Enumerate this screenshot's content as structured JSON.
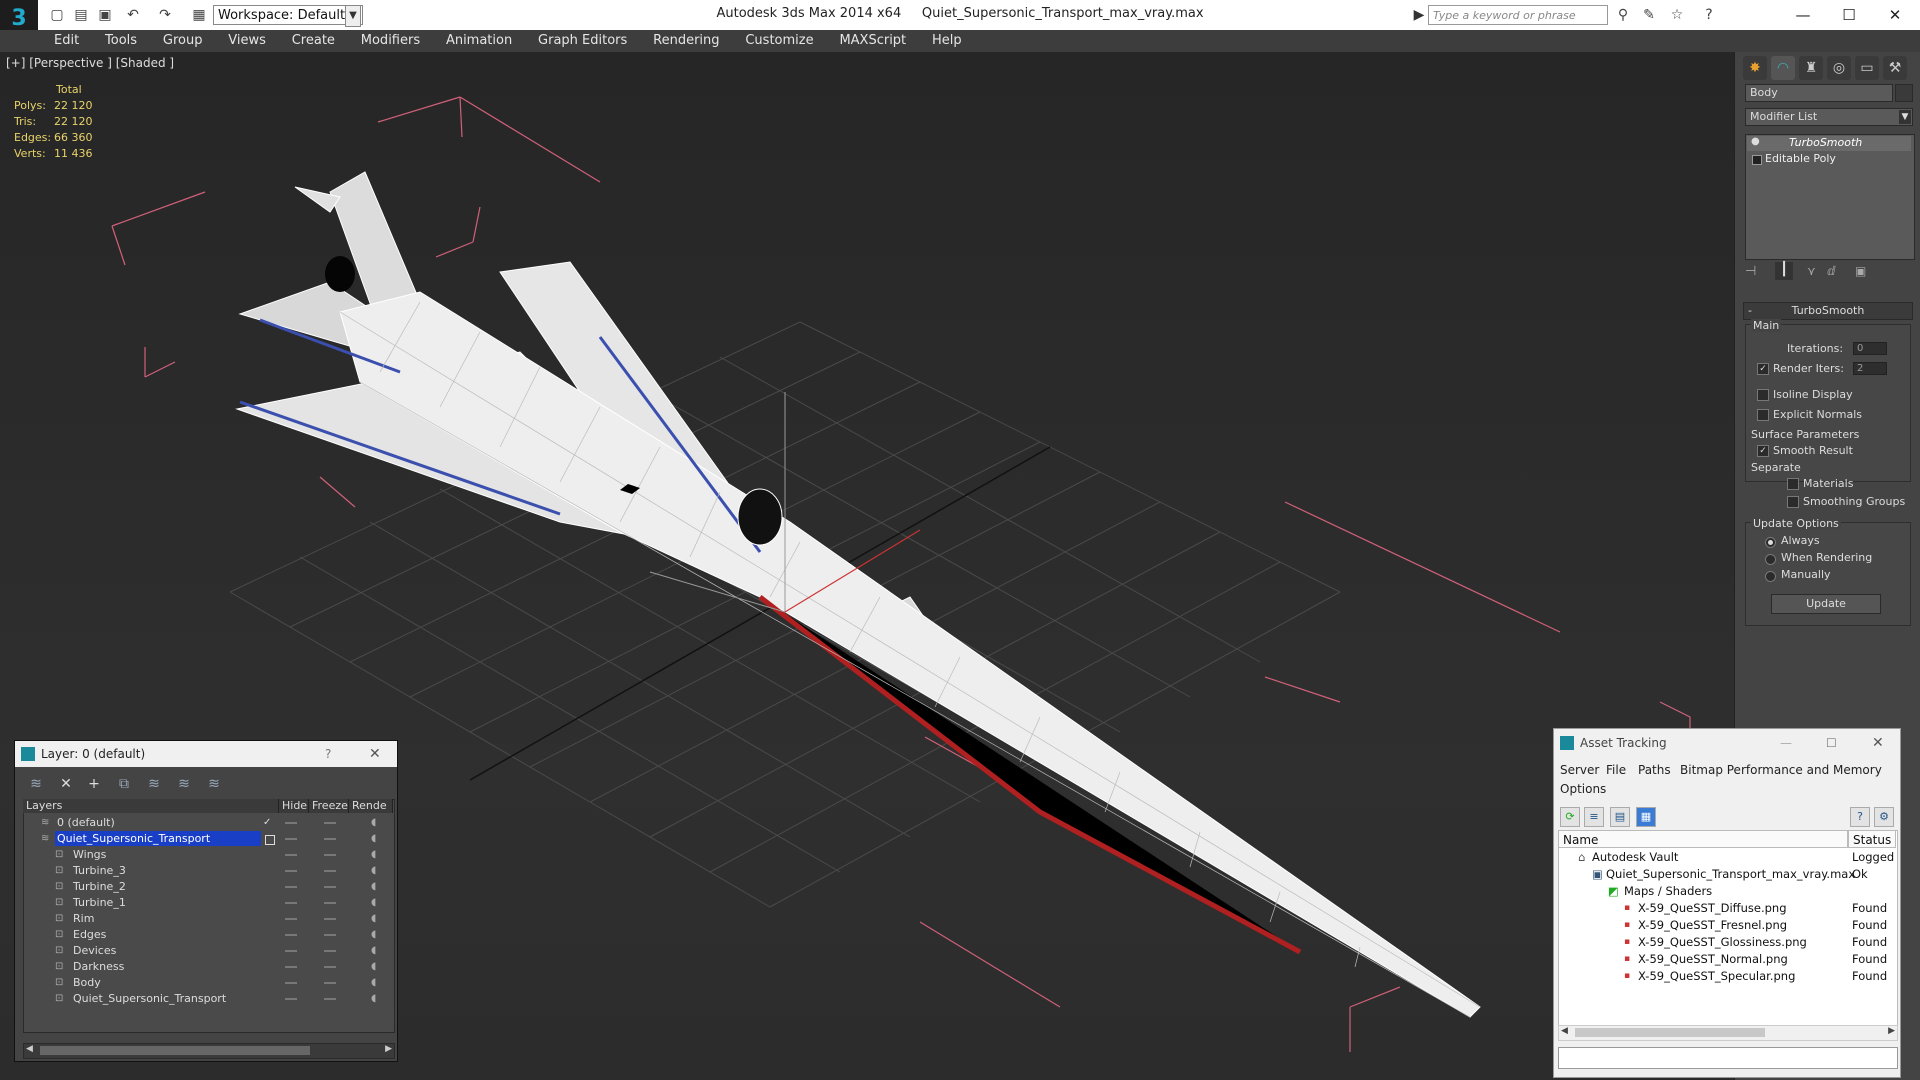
{
  "window": {
    "app_title": "Autodesk 3ds Max 2014 x64",
    "file_title": "Quiet_Supersonic_Transport_max_vray.max",
    "workspace": "Workspace: Default",
    "search_placeholder": "Type a keyword or phrase"
  },
  "menu": [
    "Edit",
    "Tools",
    "Group",
    "Views",
    "Create",
    "Modifiers",
    "Animation",
    "Graph Editors",
    "Rendering",
    "Customize",
    "MAXScript",
    "Help"
  ],
  "viewport": {
    "label": "[+] [Perspective ] [Shaded ]",
    "stats": {
      "header": "Total",
      "rows": [
        {
          "k": "Polys:",
          "v": "22 120"
        },
        {
          "k": "Tris:",
          "v": "22 120"
        },
        {
          "k": "Edges:",
          "v": "66 360"
        },
        {
          "k": "Verts:",
          "v": "11 436"
        }
      ]
    }
  },
  "command_panel": {
    "object_name": "Body",
    "modifier_list": "Modifier List",
    "stack": [
      "TurboSmooth",
      "Editable Poly"
    ],
    "rollout": "TurboSmooth",
    "main": "Main",
    "iterations_label": "Iterations:",
    "iterations_value": "0",
    "render_iters_label": "Render Iters:",
    "render_iters_value": "2",
    "isoline": "Isoline Display",
    "explicit_normals": "Explicit Normals",
    "surface_params": "Surface Parameters",
    "smooth_result": "Smooth Result",
    "separate": "Separate",
    "materials": "Materials",
    "smoothing_groups": "Smoothing Groups",
    "update_options": "Update Options",
    "always": "Always",
    "when_rendering": "When Rendering",
    "manually": "Manually",
    "update_btn": "Update"
  },
  "layer_dialog": {
    "title": "Layer: 0 (default)",
    "help": "?",
    "cols": {
      "layers": "Layers",
      "hide": "Hide",
      "freeze": "Freeze",
      "render": "Rende"
    },
    "rows": [
      "0 (default)",
      "Quiet_Supersonic_Transport",
      "Wings",
      "Turbine_3",
      "Turbine_2",
      "Turbine_1",
      "Rim",
      "Edges",
      "Devices",
      "Darkness",
      "Body",
      "Quiet_Supersonic_Transport"
    ]
  },
  "asset_dialog": {
    "title": "Asset Tracking",
    "menu": [
      "Server",
      "File",
      "Paths",
      "Bitmap Performance and Memory",
      "Options"
    ],
    "cols": {
      "name": "Name",
      "status": "Status"
    },
    "rows": [
      {
        "name": "Autodesk Vault",
        "status": "Logged O"
      },
      {
        "name": "Quiet_Supersonic_Transport_max_vray.max",
        "status": "Ok"
      },
      {
        "name": "Maps / Shaders",
        "status": ""
      },
      {
        "name": "X-59_QueSST_Diffuse.png",
        "status": "Found"
      },
      {
        "name": "X-59_QueSST_Fresnel.png",
        "status": "Found"
      },
      {
        "name": "X-59_QueSST_Glossiness.png",
        "status": "Found"
      },
      {
        "name": "X-59_QueSST_Normal.png",
        "status": "Found"
      },
      {
        "name": "X-59_QueSST_Specular.png",
        "status": "Found"
      }
    ]
  }
}
